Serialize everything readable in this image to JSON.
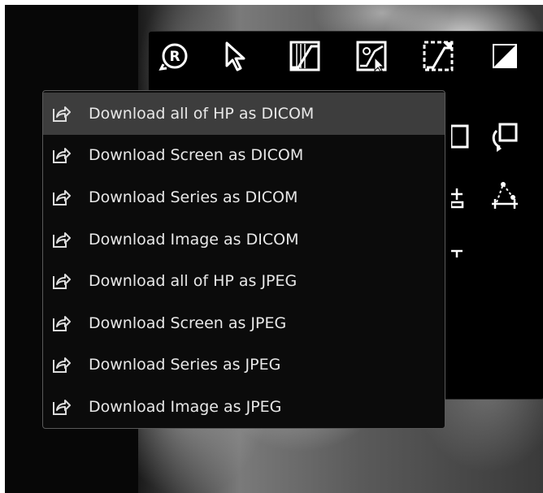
{
  "menu": {
    "items": [
      {
        "label": "Download all of HP as DICOM",
        "icon": "export-icon"
      },
      {
        "label": "Download Screen as DICOM",
        "icon": "export-icon"
      },
      {
        "label": "Download Series as DICOM",
        "icon": "export-icon"
      },
      {
        "label": "Download Image as DICOM",
        "icon": "export-icon"
      },
      {
        "label": "Download all of HP as JPEG",
        "icon": "export-icon"
      },
      {
        "label": "Download Screen as JPEG",
        "icon": "export-icon"
      },
      {
        "label": "Download Series as JPEG",
        "icon": "export-icon"
      },
      {
        "label": "Download Image as JPEG",
        "icon": "export-icon"
      }
    ]
  },
  "toolbar": {
    "tools": [
      {
        "icon": "reset-icon",
        "glyph": "R"
      },
      {
        "icon": "pointer-icon"
      },
      {
        "icon": "window-level-icon"
      },
      {
        "icon": "window-level-preset-icon"
      },
      {
        "icon": "roi-window-icon"
      },
      {
        "icon": "invert-icon"
      },
      {
        "icon": "rotate-icon"
      },
      {
        "icon": "angle-measure-icon"
      }
    ]
  },
  "colors": {
    "background": "#070707",
    "menu_bg": "#0b0b0b",
    "menu_highlight": "#3d3d3d",
    "menu_text": "#e8e8e8",
    "menu_border": "#5a5a5a"
  }
}
